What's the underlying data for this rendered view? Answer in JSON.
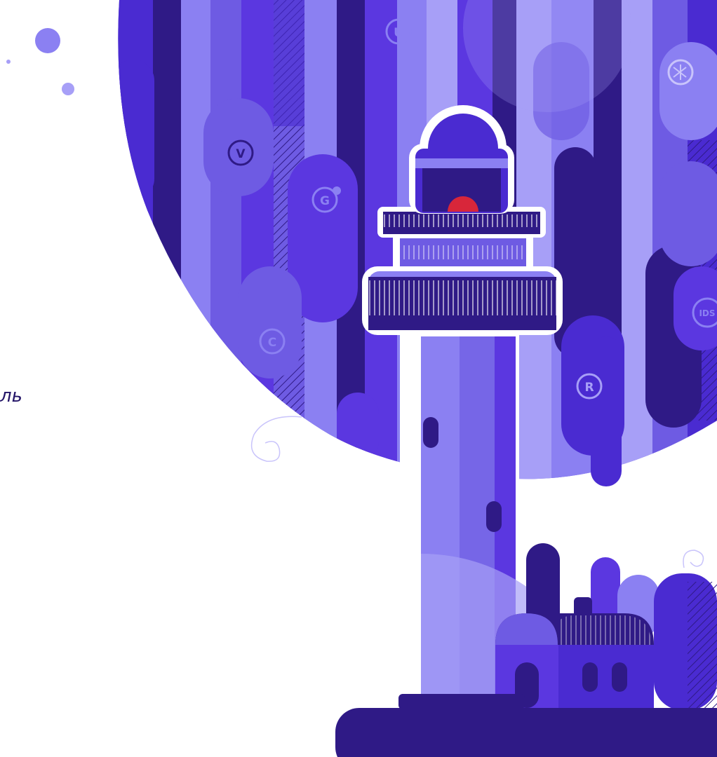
{
  "page": {
    "clipped_text": "ль"
  },
  "badges": {
    "u": "U",
    "v": "V",
    "g": "G",
    "c": "C",
    "r": "R",
    "ids": "IDS"
  },
  "colors": {
    "deep_navy": "#231467",
    "dark_violet": "#2f1a86",
    "indigo": "#4a2bd1",
    "violet": "#5b37e0",
    "medium_purple": "#6e5be3",
    "lavender": "#8b80f2",
    "light_lavender": "#a79ff7",
    "accent_red": "#d8263a"
  },
  "icons": {
    "hub": "network-hub-icon",
    "lighthouse": "lighthouse-icon"
  }
}
